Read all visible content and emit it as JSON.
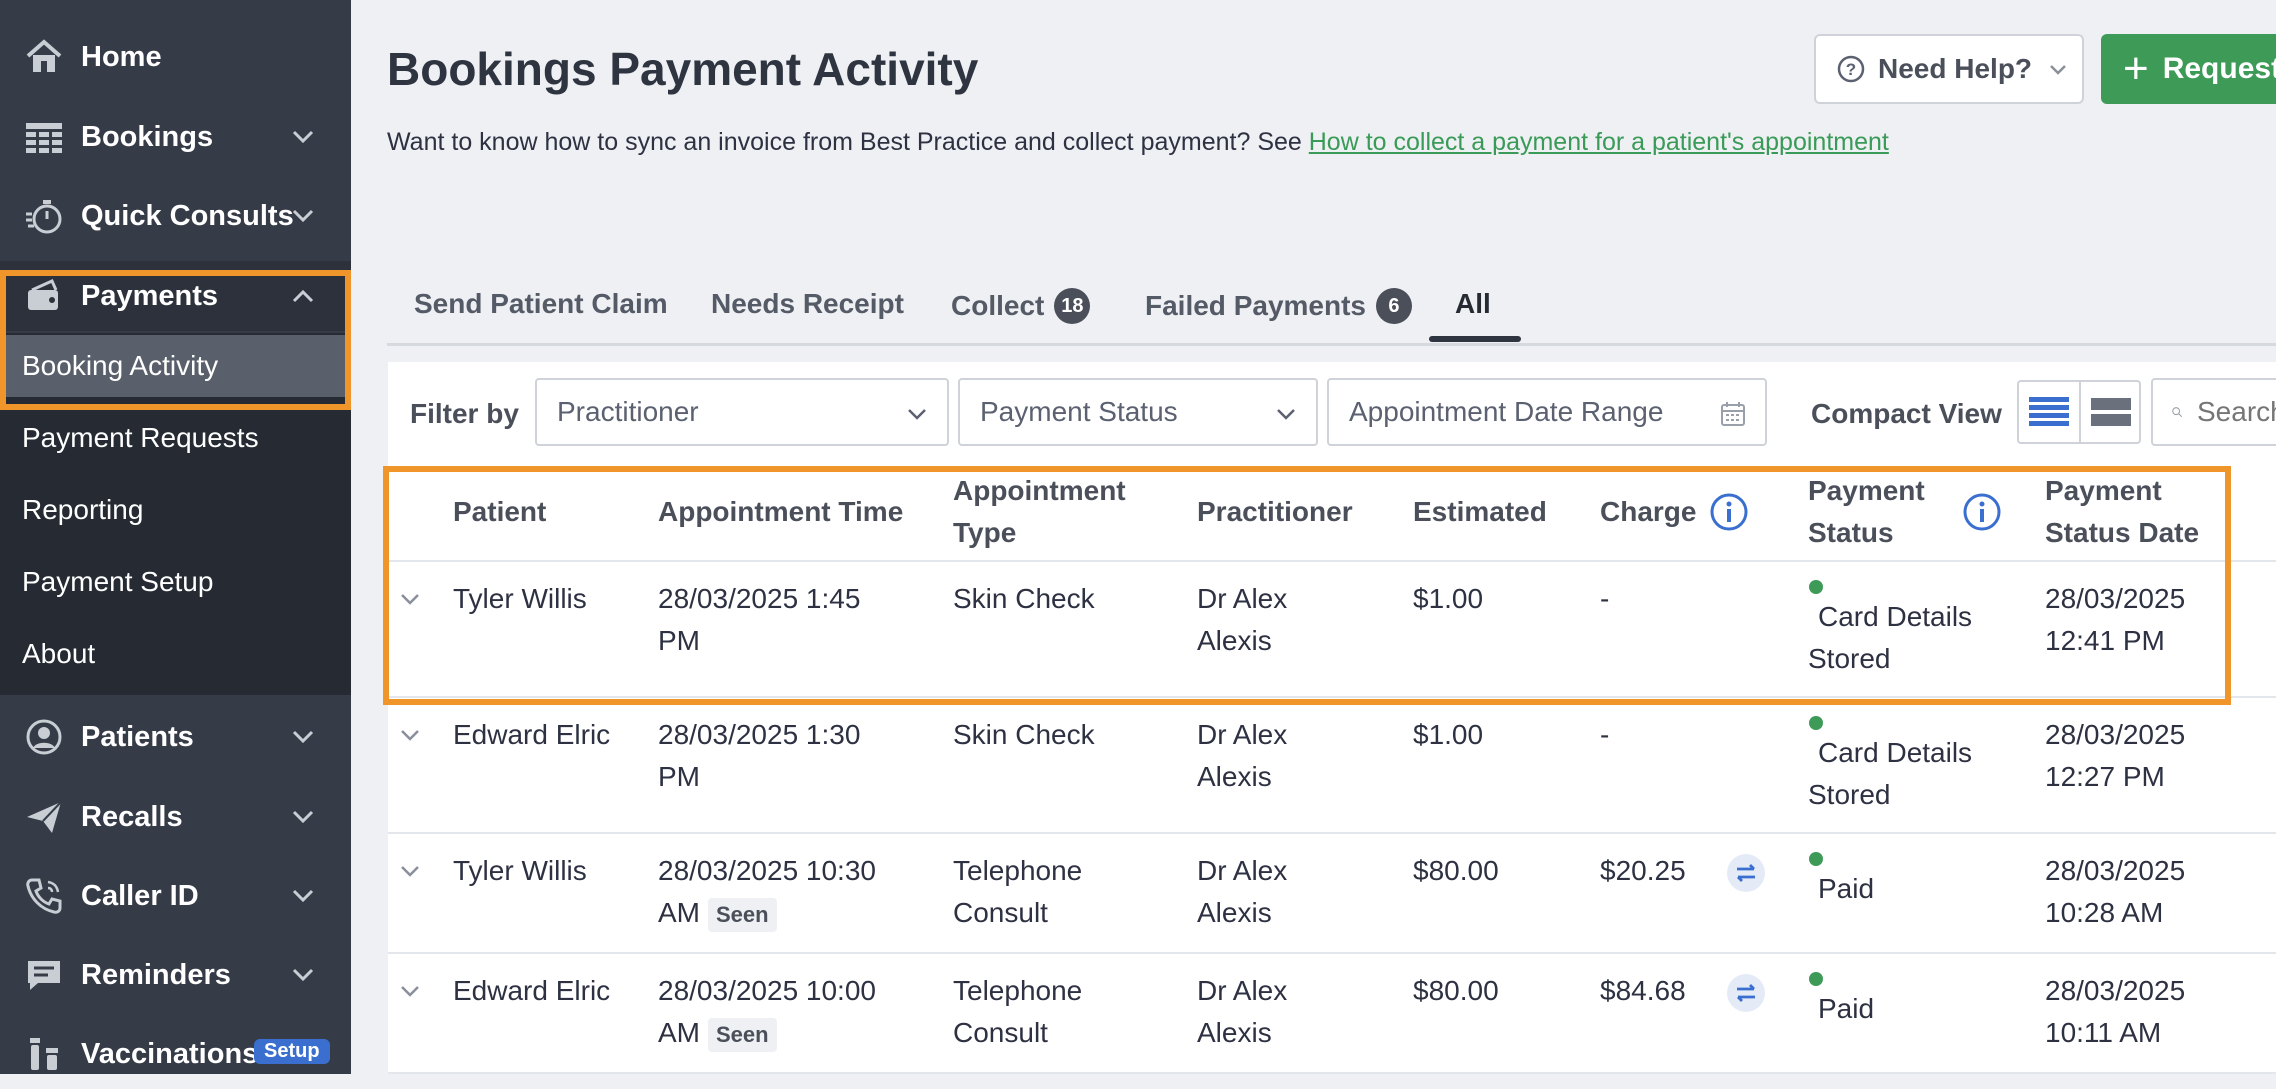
{
  "sidebar": {
    "items": [
      {
        "label": "Home",
        "icon": "home-icon"
      },
      {
        "label": "Bookings",
        "icon": "grid-icon"
      },
      {
        "label": "Quick Consults",
        "icon": "stopwatch-icon"
      },
      {
        "label": "Payments",
        "icon": "wallet-icon"
      },
      {
        "label": "Patients",
        "icon": "user-circle-icon"
      },
      {
        "label": "Recalls",
        "icon": "paper-plane-icon"
      },
      {
        "label": "Caller ID",
        "icon": "phone-icon"
      },
      {
        "label": "Reminders",
        "icon": "chat-icon"
      },
      {
        "label": "Vaccinations",
        "icon": "vials-icon"
      }
    ],
    "sub_items": [
      "Booking Activity",
      "Payment Requests",
      "Reporting",
      "Payment Setup",
      "About"
    ],
    "vaccinations_badge": "Setup"
  },
  "header": {
    "title": "Bookings Payment Activity",
    "intro_text": "Want to know how to sync an invoice from Best Practice and collect payment? See ",
    "intro_link": "How to collect a payment for a patient's appointment",
    "help_button": "Need Help?",
    "request_button": "Request"
  },
  "tabs": [
    {
      "label": "Send Patient Claim"
    },
    {
      "label": "Needs Receipt"
    },
    {
      "label": "Collect",
      "count": "18"
    },
    {
      "label": "Failed Payments",
      "count": "6"
    },
    {
      "label": "All"
    }
  ],
  "filters": {
    "label": "Filter by",
    "practitioner": "Practitioner",
    "payment_status": "Payment Status",
    "date_range": "Appointment Date Range",
    "compact_view": "Compact View",
    "search_placeholder": "Search"
  },
  "table": {
    "headers": {
      "patient": "Patient",
      "appointment_time": "Appointment Time",
      "appointment_type_1": "Appointment",
      "appointment_type_2": "Type",
      "practitioner": "Practitioner",
      "estimated": "Estimated",
      "charge": "Charge",
      "payment_status_1": "Payment",
      "payment_status_2": "Status",
      "status_date_1": "Payment",
      "status_date_2": "Status Date"
    },
    "rows": [
      {
        "patient": "Tyler Willis",
        "time_1": "28/03/2025 1:45",
        "time_2": "PM",
        "seen": "",
        "type_1": "Skin Check",
        "type_2": "",
        "practitioner_1": "Dr Alex",
        "practitioner_2": "Alexis",
        "estimated": "$1.00",
        "charge": "-",
        "status_1": "Card Details",
        "status_2": "Stored",
        "date_1": "28/03/2025",
        "date_2": "12:41 PM"
      },
      {
        "patient": "Edward Elric",
        "time_1": "28/03/2025 1:30",
        "time_2": "PM",
        "seen": "",
        "type_1": "Skin Check",
        "type_2": "",
        "practitioner_1": "Dr Alex",
        "practitioner_2": "Alexis",
        "estimated": "$1.00",
        "charge": "-",
        "status_1": "Card Details",
        "status_2": "Stored",
        "date_1": "28/03/2025",
        "date_2": "12:27 PM"
      },
      {
        "patient": "Tyler Willis",
        "time_1": "28/03/2025 10:30",
        "time_2": "AM",
        "seen": "Seen",
        "type_1": "Telephone",
        "type_2": "Consult",
        "practitioner_1": "Dr Alex",
        "practitioner_2": "Alexis",
        "estimated": "$80.00",
        "charge": "$20.25",
        "status_1": "Paid",
        "status_2": "",
        "date_1": "28/03/2025",
        "date_2": "10:28 AM"
      },
      {
        "patient": "Edward Elric",
        "time_1": "28/03/2025 10:00",
        "time_2": "AM",
        "seen": "Seen",
        "type_1": "Telephone",
        "type_2": "Consult",
        "practitioner_1": "Dr Alex",
        "practitioner_2": "Alexis",
        "estimated": "$80.00",
        "charge": "$84.68",
        "status_1": "Paid",
        "status_2": "",
        "date_1": "28/03/2025",
        "date_2": "10:11 AM"
      }
    ]
  },
  "colors": {
    "sidebar_bg": "#353b47",
    "highlight": "#f0952a",
    "accent_green": "#3d9a57",
    "info_blue": "#3a6fd0",
    "status_green": "#3d9a57"
  }
}
